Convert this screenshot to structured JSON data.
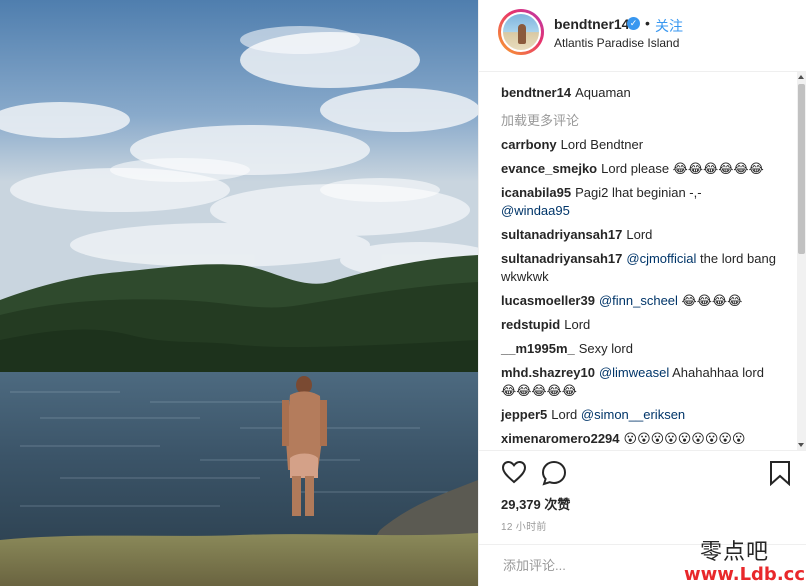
{
  "post": {
    "username": "bendtner14",
    "verified_icon": "✓",
    "separator": "•",
    "follow_label": "关注",
    "location": "Atlantis Paradise Island"
  },
  "caption": {
    "username": "bendtner14",
    "text": "Aquaman"
  },
  "load_more_label": "加载更多评论",
  "comments": [
    {
      "username": "carrbony",
      "text": "Lord Bendtner"
    },
    {
      "username": "evance_smejko",
      "text": "Lord please 😂😂😂😂😂😂"
    },
    {
      "username": "icanabila95",
      "text": "Pagi2 lhat beginian -,-",
      "mention": "@windaa95"
    },
    {
      "username": "sultanadriyansah17",
      "text": "Lord"
    },
    {
      "username": "sultanadriyansah17",
      "mention": "@cjmofficial",
      "text": "the lord bang wkwkwk"
    },
    {
      "username": "lucasmoeller39",
      "mention": "@finn_scheel",
      "text": "😂😂😂😂"
    },
    {
      "username": "redstupid",
      "text": "Lord"
    },
    {
      "username": "__m1995m_",
      "text": "Sexy lord"
    },
    {
      "username": "mhd.shazrey10",
      "mention": "@limweasel",
      "text": "Ahahahhaa lord 😂😂😂😂😂"
    },
    {
      "username": "jepper5",
      "text": "Lord",
      "mention": "@simon__eriksen"
    },
    {
      "username": "ximenaromero2294",
      "text": "😮😮😮😮😮😮😮😮😮"
    }
  ],
  "likes": {
    "count": "29,379",
    "label": "次赞"
  },
  "time": "12 小时前",
  "add_comment_placeholder": "添加评论...",
  "icons": {
    "like": "heart-icon",
    "comment": "comment-icon",
    "save": "bookmark-icon"
  },
  "watermark": {
    "line1": "零点吧",
    "line2": "www.Ldb.cc"
  },
  "colors": {
    "link": "#3897f0",
    "mention": "#003569",
    "muted": "#999999",
    "watermark": "#e8282b"
  }
}
